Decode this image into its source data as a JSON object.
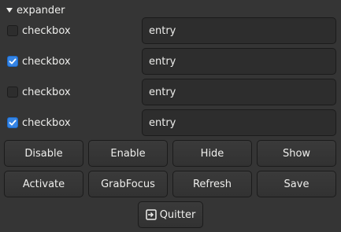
{
  "expander": {
    "label": "expander"
  },
  "rows": [
    {
      "checkbox_label": "checkbox",
      "checked": false,
      "entry_value": "entry"
    },
    {
      "checkbox_label": "checkbox",
      "checked": true,
      "entry_value": "entry"
    },
    {
      "checkbox_label": "checkbox",
      "checked": false,
      "entry_value": "entry"
    },
    {
      "checkbox_label": "checkbox",
      "checked": true,
      "entry_value": "entry"
    }
  ],
  "buttons_row1": [
    "Disable",
    "Enable",
    "Hide",
    "Show"
  ],
  "buttons_row2": [
    "Activate",
    "GrabFocus",
    "Refresh",
    "Save"
  ],
  "quit": {
    "label": "Quitter",
    "icon": "exit-icon"
  },
  "colors": {
    "background": "#353535",
    "accent": "#3584e4",
    "text": "#eeeeec"
  }
}
